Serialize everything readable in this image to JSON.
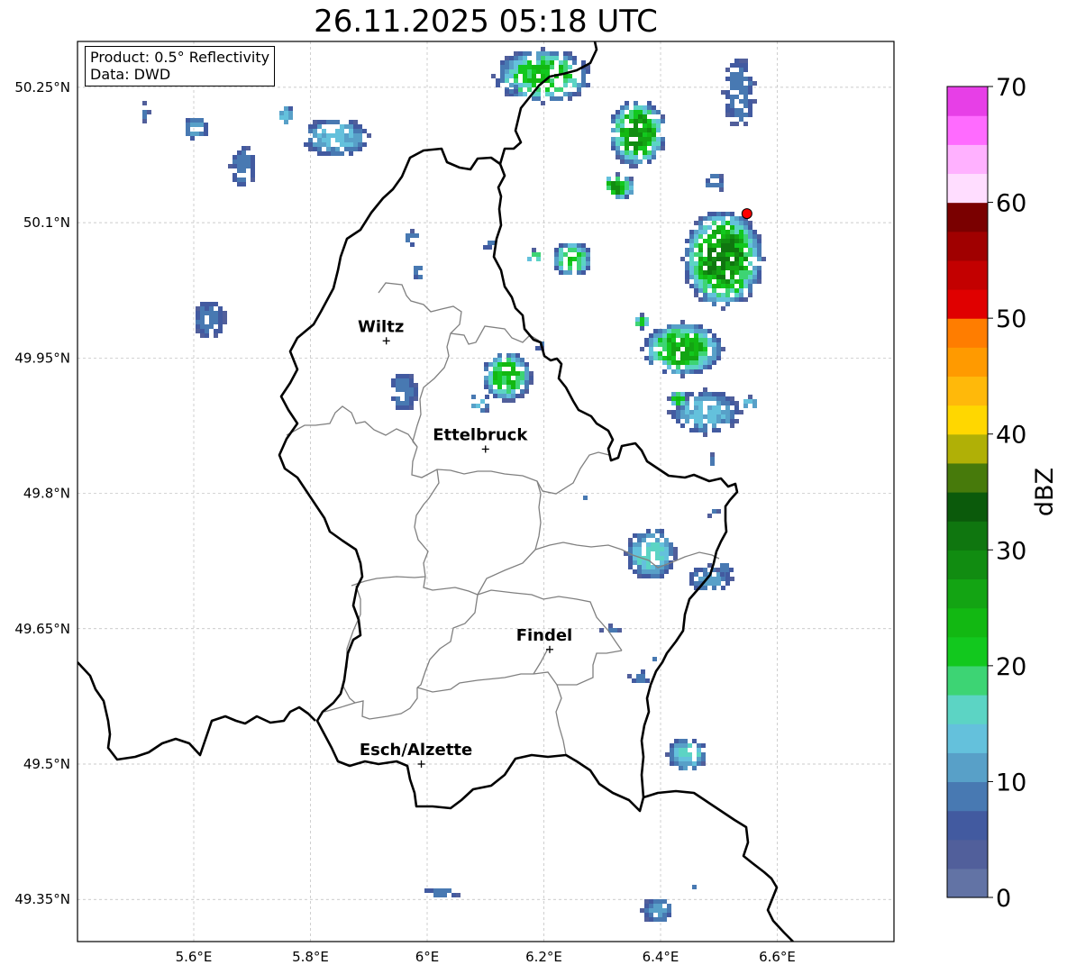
{
  "title": "26.11.2025 05:18 UTC",
  "info_box": {
    "product": "Product: 0.5° Reflectivity",
    "source": "Data: DWD"
  },
  "axes": {
    "lon_ticks": [
      5.6,
      5.8,
      6.0,
      6.2,
      6.4,
      6.6
    ],
    "lon_labels": [
      "5.6°E",
      "5.8°E",
      "6°E",
      "6.2°E",
      "6.4°E",
      "6.6°E"
    ],
    "lat_ticks": [
      50.25,
      50.1,
      49.95,
      49.8,
      49.65,
      49.5,
      49.35
    ],
    "lat_labels": [
      "50.25°N",
      "50.1°N",
      "49.95°N",
      "49.8°N",
      "49.65°N",
      "49.5°N",
      "49.35°N"
    ],
    "lon_range": [
      5.4,
      6.8
    ],
    "lat_range": [
      49.3,
      50.3
    ],
    "grid": true
  },
  "cities": [
    {
      "name": "Wiltz",
      "lon": 5.93,
      "lat": 49.969
    },
    {
      "name": "Ettelbruck",
      "lon": 6.1,
      "lat": 49.849
    },
    {
      "name": "Findel",
      "lon": 6.21,
      "lat": 49.627
    },
    {
      "name": "Esch/Alzette",
      "lon": 5.99,
      "lat": 49.5
    }
  ],
  "radar_marker": {
    "lon": 6.548,
    "lat": 50.11,
    "color": "#ff0000"
  },
  "colorbar": {
    "label": "dBZ",
    "min": 0,
    "max": 70,
    "ticks": [
      0,
      10,
      20,
      30,
      40,
      50,
      60,
      70
    ],
    "tick_labels": [
      "0",
      "10",
      "20",
      "30",
      "40",
      "50",
      "60",
      "70"
    ],
    "colors": [
      "#6273a5",
      "#515f9b",
      "#425aa0",
      "#4879b2",
      "#58a0c8",
      "#64c1dc",
      "#5cd4c4",
      "#3dd474",
      "#12c81e",
      "#12b812",
      "#13a413",
      "#118c11",
      "#0f760f",
      "#0b5a0b",
      "#477a0b",
      "#b0b006",
      "#ffd700",
      "#ffb90a",
      "#ff9a00",
      "#ff7d00",
      "#e00000",
      "#c30000",
      "#a00000",
      "#7a0000",
      "#ffddff",
      "#ffb1ff",
      "#ff6bff",
      "#e73fe7"
    ]
  },
  "colors": {
    "country_border": "#000000",
    "canton_border": "#808080",
    "grid": "#bbbbbb"
  }
}
